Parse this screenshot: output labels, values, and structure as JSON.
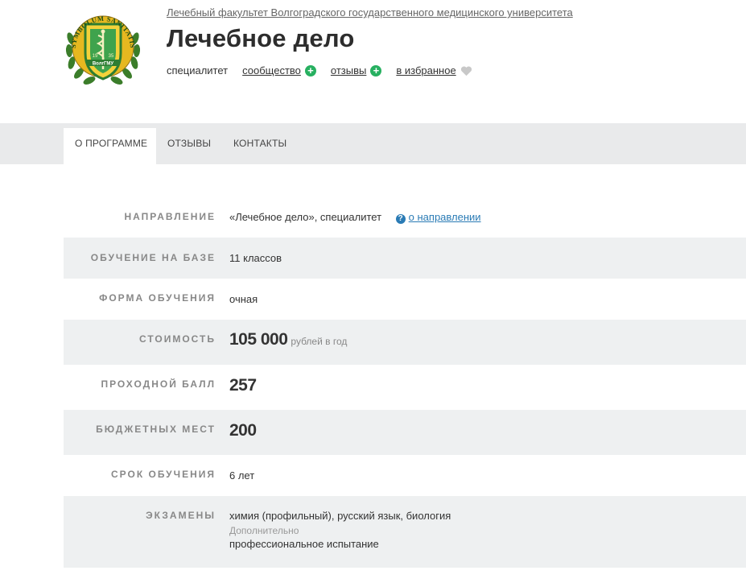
{
  "header": {
    "faculty_link": "Лечебный факультет Волгоградского государственного медицинского университета",
    "title": "Лечебное дело",
    "meta": {
      "level": "специалитет",
      "community": "сообщество",
      "reviews": "отзывы",
      "favorite": "в избранное"
    },
    "logo_text": {
      "motto": "SYMBOLUM SANITATIS",
      "abbr": "ВолгГМУ",
      "year_left": "19",
      "year_right": "35"
    }
  },
  "tabs": [
    {
      "label": "О ПРОГРАММЕ",
      "active": true
    },
    {
      "label": "ОТЗЫВЫ",
      "active": false
    },
    {
      "label": "КОНТАКТЫ",
      "active": false
    }
  ],
  "info": {
    "direction": {
      "label": "НАПРАВЛЕНИЕ",
      "value": "«Лечебное дело», специалитет",
      "help_link": "о направлении"
    },
    "basis": {
      "label": "ОБУЧЕНИЕ НА БАЗЕ",
      "value": "11 классов"
    },
    "form": {
      "label": "ФОРМА ОБУЧЕНИЯ",
      "value": "очная"
    },
    "cost": {
      "label": "СТОИМОСТЬ",
      "value": "105 000",
      "unit": "рублей в год"
    },
    "passing_score": {
      "label": "ПРОХОДНОЙ БАЛЛ",
      "value": "257"
    },
    "budget_places": {
      "label": "БЮДЖЕТНЫХ МЕСТ",
      "value": "200"
    },
    "duration": {
      "label": "СРОК ОБУЧЕНИЯ",
      "value": "6 лет"
    },
    "exams": {
      "label": "ЭКЗАМЕНЫ",
      "value": "химия (профильный), русский язык, биология",
      "extra_label": "Дополнительно",
      "extra_value": "профессиональное испытание"
    }
  },
  "colors": {
    "accent_green": "#27b060",
    "link_blue": "#2a7bb5",
    "tab_bar": "#e9eaeb",
    "row_shade": "#eef0f1"
  }
}
